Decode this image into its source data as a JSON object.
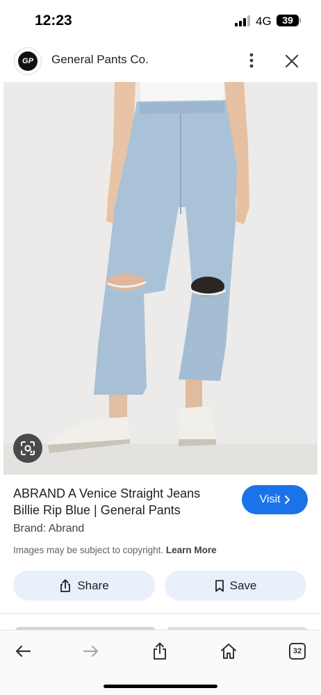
{
  "status_bar": {
    "time": "12:23",
    "network": "4G",
    "battery": "39"
  },
  "header": {
    "site_name": "General Pants Co.",
    "logo_text": "GP"
  },
  "product": {
    "title": "ABRAND A Venice Straight Jeans Billie Rip Blue | General Pants",
    "brand": "Brand: Abrand",
    "copyright": "Images may be subject to copyright.",
    "learn_more": "Learn More"
  },
  "actions": {
    "visit": "Visit",
    "share": "Share",
    "save": "Save"
  },
  "bottom_nav": {
    "tabs_count": "32"
  },
  "colors": {
    "accent": "#1a73e8",
    "action_bg": "#e8f0fc"
  }
}
